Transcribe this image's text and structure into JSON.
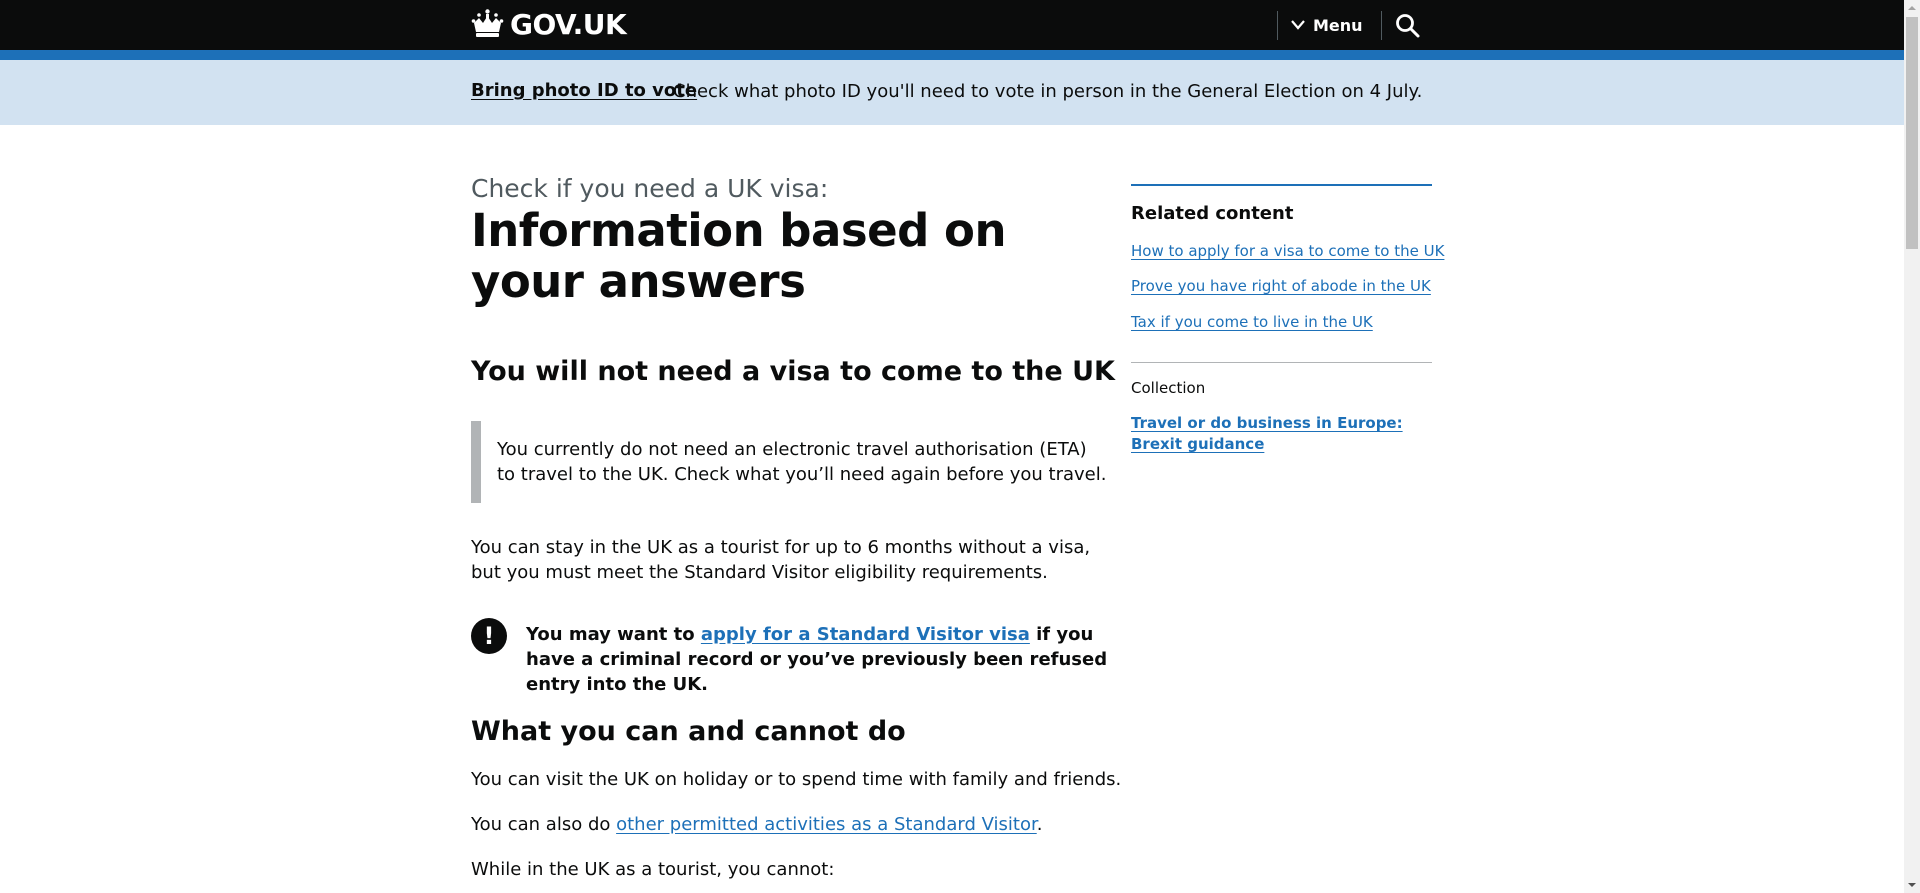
{
  "header": {
    "logo_text": "GOV.UK",
    "menu_label": "Menu",
    "colors": {
      "background": "#0b0c0c",
      "accent_bar": "#1d70b8"
    }
  },
  "banner": {
    "link_text": "Bring photo ID to vote",
    "text": "Check what photo ID you'll need to vote in person in the General Election on 4 July."
  },
  "main": {
    "caption": "Check if you need a UK visa:",
    "title": "Information based on your answers",
    "heading_no_visa": "You will not need a visa to come to the UK",
    "inset_text": "You currently do not need an electronic travel authorisation (ETA) to travel to the UK. Check what you’ll need again before you travel.",
    "stay_paragraph": "You can stay in the UK as a tourist for up to 6 months without a visa, but you must meet the Standard Visitor eligibility requirements.",
    "warning": {
      "icon": "!",
      "prefix": "You may want to ",
      "link_text": "apply for a Standard Visitor visa",
      "suffix": " if you have a criminal record or you’ve previously been refused entry into the UK."
    },
    "heading_can_cannot": "What you can and cannot do",
    "p_visit": "You can visit the UK on holiday or to spend time with family and friends.",
    "p_also_prefix": "You can also do ",
    "p_also_link": "other permitted activities as a Standard Visitor",
    "p_also_suffix": ".",
    "p_cannot": "While in the UK as a tourist, you cannot:"
  },
  "sidebar": {
    "related_heading": "Related content",
    "related_links": [
      "How to apply for a visa to come to the UK",
      "Prove you have right of abode in the UK",
      "Tax if you come to live in the UK"
    ],
    "collection_label": "Collection",
    "collection_link": "Travel or do business in Europe: Brexit guidance"
  },
  "icons": {
    "logo": "crown-icon",
    "menu": "chevron-down-icon",
    "search": "search-icon",
    "warning": "warning-icon"
  }
}
